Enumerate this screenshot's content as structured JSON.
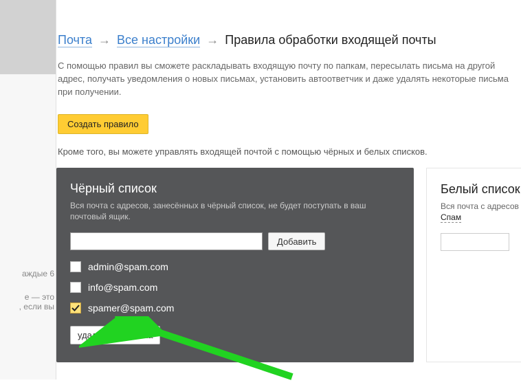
{
  "breadcrumb": {
    "mail": "Почта",
    "all_settings": "Все настройки",
    "current": "Правила обработки входящей почты"
  },
  "intro": "С помощью правил вы сможете раскладывать входящую почту по папкам, пересылать письма на другой адрес, получать уведомления о новых письмах, установить автоответчик и даже удалять некоторые письма при получении.",
  "create_rule_label": "Создать правило",
  "subintro": "Кроме того, вы можете управлять входящей почтой с помощью чёрных и белых списков.",
  "blacklist": {
    "title": "Чёрный список",
    "desc": "Вся почта с адресов, занесённых в чёрный список, не будет поступать в ваш почтовый ящик.",
    "add_label": "Добавить",
    "input_value": "",
    "items": [
      {
        "email": "admin@spam.com",
        "checked": false
      },
      {
        "email": "info@spam.com",
        "checked": false
      },
      {
        "email": "spamer@spam.com",
        "checked": true
      }
    ],
    "remove_label": "удалить из списка"
  },
  "whitelist": {
    "title": "Белый список",
    "desc_prefix": "Вся почта с адресов",
    "spam_link": "Спам"
  },
  "sidebar_fragments": {
    "l1": "аждые 6",
    "l2": "е — это",
    "l3": ", если вы"
  }
}
